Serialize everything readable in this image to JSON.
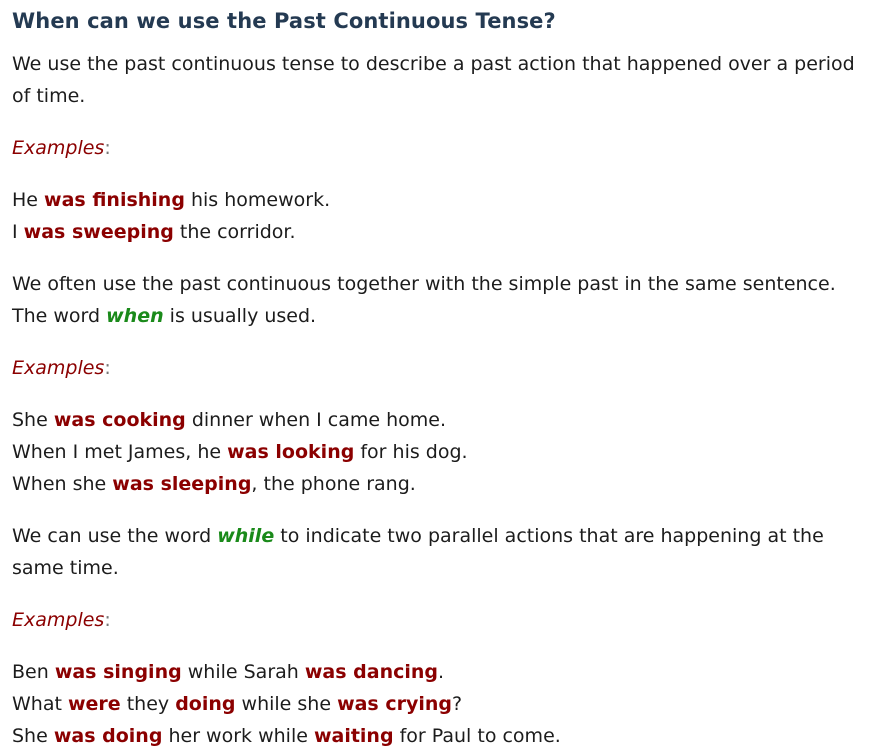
{
  "title": "When can we use the Past Continuous Tense?",
  "section1": {
    "intro": "We use the past continuous tense to describe a past action that happened over a period of time.",
    "examples_label": "Examples",
    "examples": [
      {
        "pre": "He ",
        "verb": "was finishing",
        "post": " his homework."
      },
      {
        "pre": "I ",
        "verb": "was sweeping",
        "post": " the corridor."
      }
    ]
  },
  "section2": {
    "intro_pre": "We often use the past continuous together with the simple past in the same sentence. The word ",
    "keyword": "when",
    "intro_post": " is usually used.",
    "examples_label": "Examples",
    "examples": [
      {
        "pre": "She ",
        "verb": "was cooking",
        "post": " dinner when I came home."
      },
      {
        "pre": "When I met James, he ",
        "verb": "was looking",
        "post": " for his dog."
      },
      {
        "pre": "When she ",
        "verb": "was sleeping",
        "post": ", the phone rang."
      }
    ]
  },
  "section3": {
    "intro_pre": "We can use the word ",
    "keyword": "while",
    "intro_post": " to indicate two parallel actions that are happening at the same time.",
    "examples_label": "Examples",
    "ex1": {
      "pre": "Ben ",
      "verb1": "was singing",
      "mid": " while Sarah ",
      "verb2": "was dancing",
      "post": "."
    },
    "ex2": {
      "pre": "What ",
      "verb1": "were",
      "mid1": " they ",
      "verb2": "doing",
      "mid2": " while she ",
      "verb3": "was crying",
      "post": "?"
    },
    "ex3": {
      "pre": "She ",
      "verb1": "was doing",
      "mid": " her work while ",
      "verb2": "waiting",
      "post": " for Paul to come."
    }
  },
  "colors": {
    "title": "#243a52",
    "verb": "#8b0000",
    "examples_label": "#8b0000",
    "keyword": "#1a8a1a"
  }
}
